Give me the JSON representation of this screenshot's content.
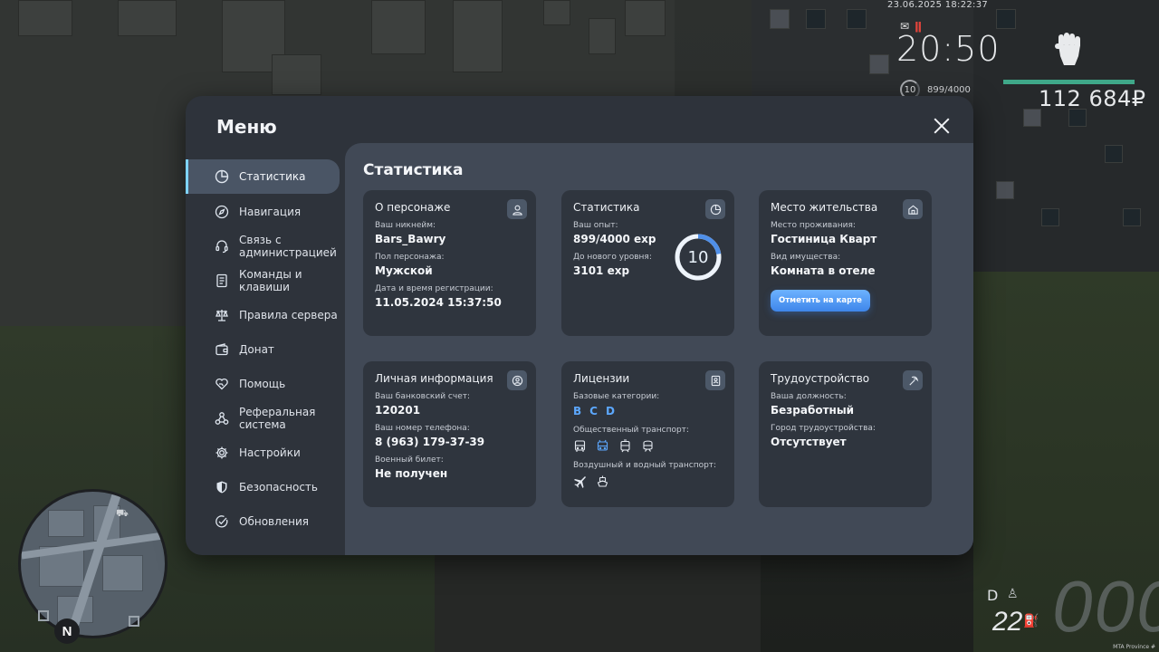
{
  "hud": {
    "date": "23.06.2025 18:22:37",
    "time": "20:50",
    "level": "10",
    "exp": "899/4000",
    "money": "112 684₽",
    "gear": "D",
    "fuel": "22",
    "speed": "000",
    "compass": "N",
    "watermark": "MTA Province #"
  },
  "menu": {
    "title": "Меню",
    "sidebar": [
      {
        "label": "Статистика",
        "icon": "pie-chart-icon",
        "active": true
      },
      {
        "label": "Навигация",
        "icon": "compass-icon"
      },
      {
        "label": "Связь с администрацией",
        "icon": "headset-icon"
      },
      {
        "label": "Команды и клавиши",
        "icon": "keyboard-icon"
      },
      {
        "label": "Правила сервера",
        "icon": "scales-icon"
      },
      {
        "label": "Донат",
        "icon": "wallet-icon"
      },
      {
        "label": "Помощь",
        "icon": "heart-hands-icon"
      },
      {
        "label": "Реферальная система",
        "icon": "network-icon"
      },
      {
        "label": "Настройки",
        "icon": "gear-icon"
      },
      {
        "label": "Безопасность",
        "icon": "shield-icon"
      },
      {
        "label": "Обновления",
        "icon": "check-circle-icon"
      }
    ]
  },
  "content": {
    "title": "Статистика",
    "character": {
      "title": "О персонаже",
      "nickname_label": "Ваш никнейм:",
      "nickname": "Bars_Bawry",
      "gender_label": "Пол персонажа:",
      "gender": "Мужской",
      "reg_label": "Дата и время регистрации:",
      "reg": "11.05.2024 15:37:50"
    },
    "stats": {
      "title": "Статистика",
      "exp_label": "Ваш опыт:",
      "exp": "899/4000 exp",
      "next_label": "До нового уровня:",
      "next": "3101 exp",
      "level": "10",
      "progress": 0.2248
    },
    "residence": {
      "title": "Место жительства",
      "place_label": "Место проживания:",
      "place": "Гостиница Кварт",
      "type_label": "Вид имущества:",
      "type": "Комната в отеле",
      "button": "Отметить на карте"
    },
    "personal": {
      "title": "Личная информация",
      "bank_label": "Ваш банковский счет:",
      "bank": "120201",
      "phone_label": "Ваш номер телефона:",
      "phone": "8 (963) 179-37-39",
      "military_label": "Военный билет:",
      "military": "Не получен"
    },
    "licenses": {
      "title": "Лицензии",
      "base_label": "Базовые категории:",
      "categories": [
        "B",
        "C",
        "D"
      ],
      "public_label": "Общественный транспорт:",
      "air_label": "Воздушный и водный транспорт:"
    },
    "employment": {
      "title": "Трудоустройство",
      "position_label": "Ваша должность:",
      "position": "Безработный",
      "city_label": "Город трудоустройства:",
      "city": "Отсутствует"
    }
  },
  "colors": {
    "accent": "#5ca8ff",
    "panel": "#2e333b",
    "card": "#2f353e",
    "hud_bar": "#3fa889"
  }
}
